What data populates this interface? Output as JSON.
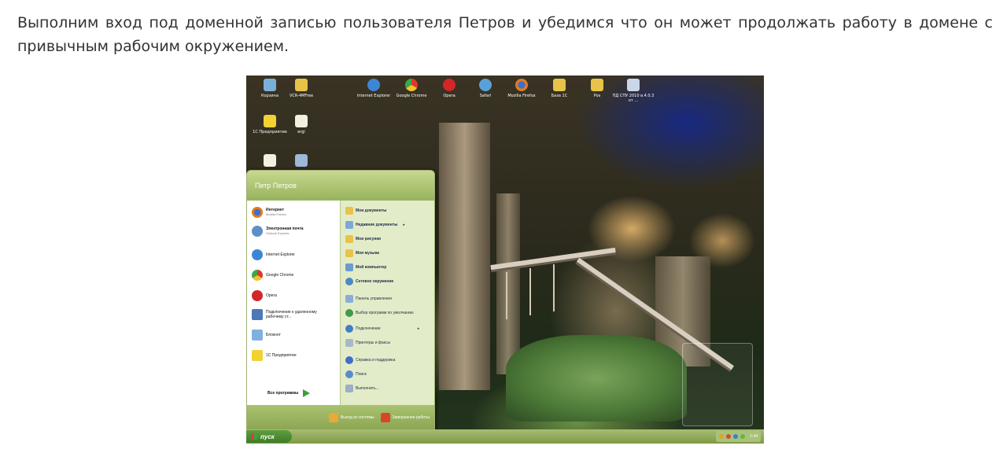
{
  "article": {
    "paragraph": "Выполним вход под доменной записью пользователя Петров и убедимся что он может продолжать работу в домене с привычным рабочим окружением."
  },
  "desktop": {
    "icons": [
      {
        "label": "Корзина",
        "icon": "recycle-bin-icon"
      },
      {
        "label": "VCR-4MFree",
        "icon": "folder-icon"
      },
      {
        "label": "Internet Explorer",
        "icon": "ie-icon"
      },
      {
        "label": "Google Chrome",
        "icon": "chrome-icon"
      },
      {
        "label": "Opera",
        "icon": "opera-icon"
      },
      {
        "label": "Safari",
        "icon": "safari-icon"
      },
      {
        "label": "Mozilla Firefox",
        "icon": "firefox-icon"
      },
      {
        "label": "База 1С",
        "icon": "folder-icon"
      },
      {
        "label": "Pos",
        "icon": "folder-icon"
      },
      {
        "label": "ПД СПУ 2010 в.4.0.3 от ...",
        "icon": "app-icon"
      },
      {
        "label": "1С Предприятие",
        "icon": "1c-icon"
      },
      {
        "label": "ergi",
        "icon": "document-icon"
      }
    ]
  },
  "start_menu": {
    "user_name": "Петр Петров",
    "pinned": [
      {
        "title": "Интернет",
        "subtitle": "Mozilla Firefox"
      },
      {
        "title": "Электронная почта",
        "subtitle": "Outlook Express"
      }
    ],
    "recent": [
      {
        "title": "Internet Explorer"
      },
      {
        "title": "Google Chrome"
      },
      {
        "title": "Opera"
      },
      {
        "title": "Подключение к удаленному рабочему ст..."
      },
      {
        "title": "Блокнот"
      },
      {
        "title": "1С Предприятие"
      }
    ],
    "all_programs": "Все программы",
    "right_items": [
      {
        "label": "Мои документы",
        "bold": true
      },
      {
        "label": "Недавние документы",
        "bold": true,
        "arrow": true
      },
      {
        "label": "Мои рисунки",
        "bold": true
      },
      {
        "label": "Моя музыка",
        "bold": true
      },
      {
        "label": "Мой компьютер",
        "bold": true
      },
      {
        "label": "Сетевое окружение",
        "bold": true
      },
      {
        "label": "Панель управления",
        "bold": false
      },
      {
        "label": "Выбор программ по умолчанию",
        "bold": false
      },
      {
        "label": "Подключение",
        "bold": false,
        "arrow": true
      },
      {
        "label": "Принтеры и факсы",
        "bold": false
      },
      {
        "label": "Справка и поддержка",
        "bold": false
      },
      {
        "label": "Поиск",
        "bold": false
      },
      {
        "label": "Выполнить...",
        "bold": false
      }
    ],
    "logoff": "Выход из системы",
    "shutdown": "Завершение работы"
  },
  "taskbar": {
    "start_label": "пуск",
    "clock": "1:44"
  }
}
